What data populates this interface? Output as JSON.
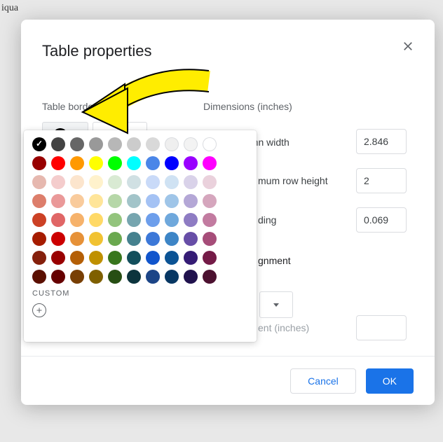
{
  "bg_text": "iqua",
  "dialog": {
    "title": "Table properties",
    "sections": {
      "border_label": "Table border",
      "dimensions_label": "Dimensions  (inches)",
      "column_width_label": "Column width",
      "column_width_value": "2.846",
      "row_height_label": "mum row height",
      "row_height_value": "2",
      "padding_label": "ding",
      "padding_value": "0.069",
      "alignment_label": "gnment",
      "indent_label": "ent  (inches)"
    },
    "buttons": {
      "cancel": "Cancel",
      "ok": "OK"
    }
  },
  "picker": {
    "custom_label": "CUSTOM",
    "rows": [
      [
        {
          "c": "#000000",
          "sel": true
        },
        {
          "c": "#434343"
        },
        {
          "c": "#666666"
        },
        {
          "c": "#999999"
        },
        {
          "c": "#b7b7b7"
        },
        {
          "c": "#cccccc"
        },
        {
          "c": "#d9d9d9"
        },
        {
          "c": "#efefef",
          "b": true
        },
        {
          "c": "#f3f3f3",
          "b": true
        },
        {
          "c": "#ffffff",
          "b": true
        }
      ],
      [
        {
          "c": "#980000"
        },
        {
          "c": "#ff0000"
        },
        {
          "c": "#ff9900"
        },
        {
          "c": "#ffff00"
        },
        {
          "c": "#00ff00"
        },
        {
          "c": "#00ffff"
        },
        {
          "c": "#4a86e8"
        },
        {
          "c": "#0000ff"
        },
        {
          "c": "#9900ff"
        },
        {
          "c": "#ff00ff"
        }
      ],
      [
        {
          "c": "#e6b8af"
        },
        {
          "c": "#f4cccc"
        },
        {
          "c": "#fce5cd"
        },
        {
          "c": "#fff2cc"
        },
        {
          "c": "#d9ead3"
        },
        {
          "c": "#d0e0e3"
        },
        {
          "c": "#c9daf8"
        },
        {
          "c": "#cfe2f3"
        },
        {
          "c": "#d9d2e9"
        },
        {
          "c": "#ead1dc"
        }
      ],
      [
        {
          "c": "#dd7e6b"
        },
        {
          "c": "#ea9999"
        },
        {
          "c": "#f9cb9c"
        },
        {
          "c": "#ffe599"
        },
        {
          "c": "#b6d7a8"
        },
        {
          "c": "#a2c4c9"
        },
        {
          "c": "#a4c2f4"
        },
        {
          "c": "#9fc5e8"
        },
        {
          "c": "#b4a7d6"
        },
        {
          "c": "#d5a6bd"
        }
      ],
      [
        {
          "c": "#cc4125"
        },
        {
          "c": "#e06666"
        },
        {
          "c": "#f6b26b"
        },
        {
          "c": "#ffd966"
        },
        {
          "c": "#93c47d"
        },
        {
          "c": "#76a5af"
        },
        {
          "c": "#6d9eeb"
        },
        {
          "c": "#6fa8dc"
        },
        {
          "c": "#8e7cc3"
        },
        {
          "c": "#c27ba0"
        }
      ],
      [
        {
          "c": "#a61c00"
        },
        {
          "c": "#cc0000"
        },
        {
          "c": "#e69138"
        },
        {
          "c": "#f1c232"
        },
        {
          "c": "#6aa84f"
        },
        {
          "c": "#45818e"
        },
        {
          "c": "#3c78d8"
        },
        {
          "c": "#3d85c6"
        },
        {
          "c": "#674ea7"
        },
        {
          "c": "#a64d79"
        }
      ],
      [
        {
          "c": "#85200c"
        },
        {
          "c": "#990000"
        },
        {
          "c": "#b45f06"
        },
        {
          "c": "#bf9000"
        },
        {
          "c": "#38761d"
        },
        {
          "c": "#134f5c"
        },
        {
          "c": "#1155cc"
        },
        {
          "c": "#0b5394"
        },
        {
          "c": "#351c75"
        },
        {
          "c": "#741b47"
        }
      ],
      [
        {
          "c": "#5b0f00"
        },
        {
          "c": "#660000"
        },
        {
          "c": "#783f04"
        },
        {
          "c": "#7f6000"
        },
        {
          "c": "#274e13"
        },
        {
          "c": "#0c343d"
        },
        {
          "c": "#1c4587"
        },
        {
          "c": "#073763"
        },
        {
          "c": "#20124d"
        },
        {
          "c": "#4c1130"
        }
      ]
    ]
  }
}
